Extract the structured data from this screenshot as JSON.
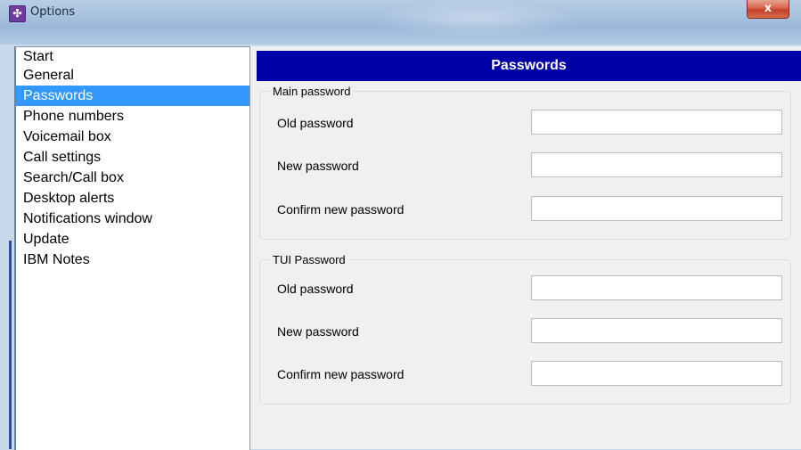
{
  "window": {
    "title": "Options",
    "close_label": "x",
    "app_icon_glyph": "✣"
  },
  "sidebar": {
    "items": [
      {
        "label": "Start",
        "selected": false
      },
      {
        "label": "General",
        "selected": false
      },
      {
        "label": "Passwords",
        "selected": true
      },
      {
        "label": "Phone numbers",
        "selected": false
      },
      {
        "label": "Voicemail box",
        "selected": false
      },
      {
        "label": "Call settings",
        "selected": false
      },
      {
        "label": "Search/Call box",
        "selected": false
      },
      {
        "label": "Desktop alerts",
        "selected": false
      },
      {
        "label": "Notifications window",
        "selected": false
      },
      {
        "label": "Update",
        "selected": false
      },
      {
        "label": "IBM Notes",
        "selected": false
      }
    ]
  },
  "panel": {
    "title": "Passwords",
    "header_color": "#0000a8"
  },
  "main_password": {
    "legend": "Main password",
    "old_label": "Old password",
    "old_value": "",
    "new_label": "New password",
    "new_value": "",
    "confirm_label": "Confirm new password",
    "confirm_value": ""
  },
  "tui_password": {
    "legend": "TUI Password",
    "old_label": "Old password",
    "old_value": "",
    "new_label": "New password",
    "new_value": "",
    "confirm_label": "Confirm new password",
    "confirm_value": ""
  },
  "colors": {
    "selection": "#3399ff",
    "close_button": "#c5402a"
  }
}
